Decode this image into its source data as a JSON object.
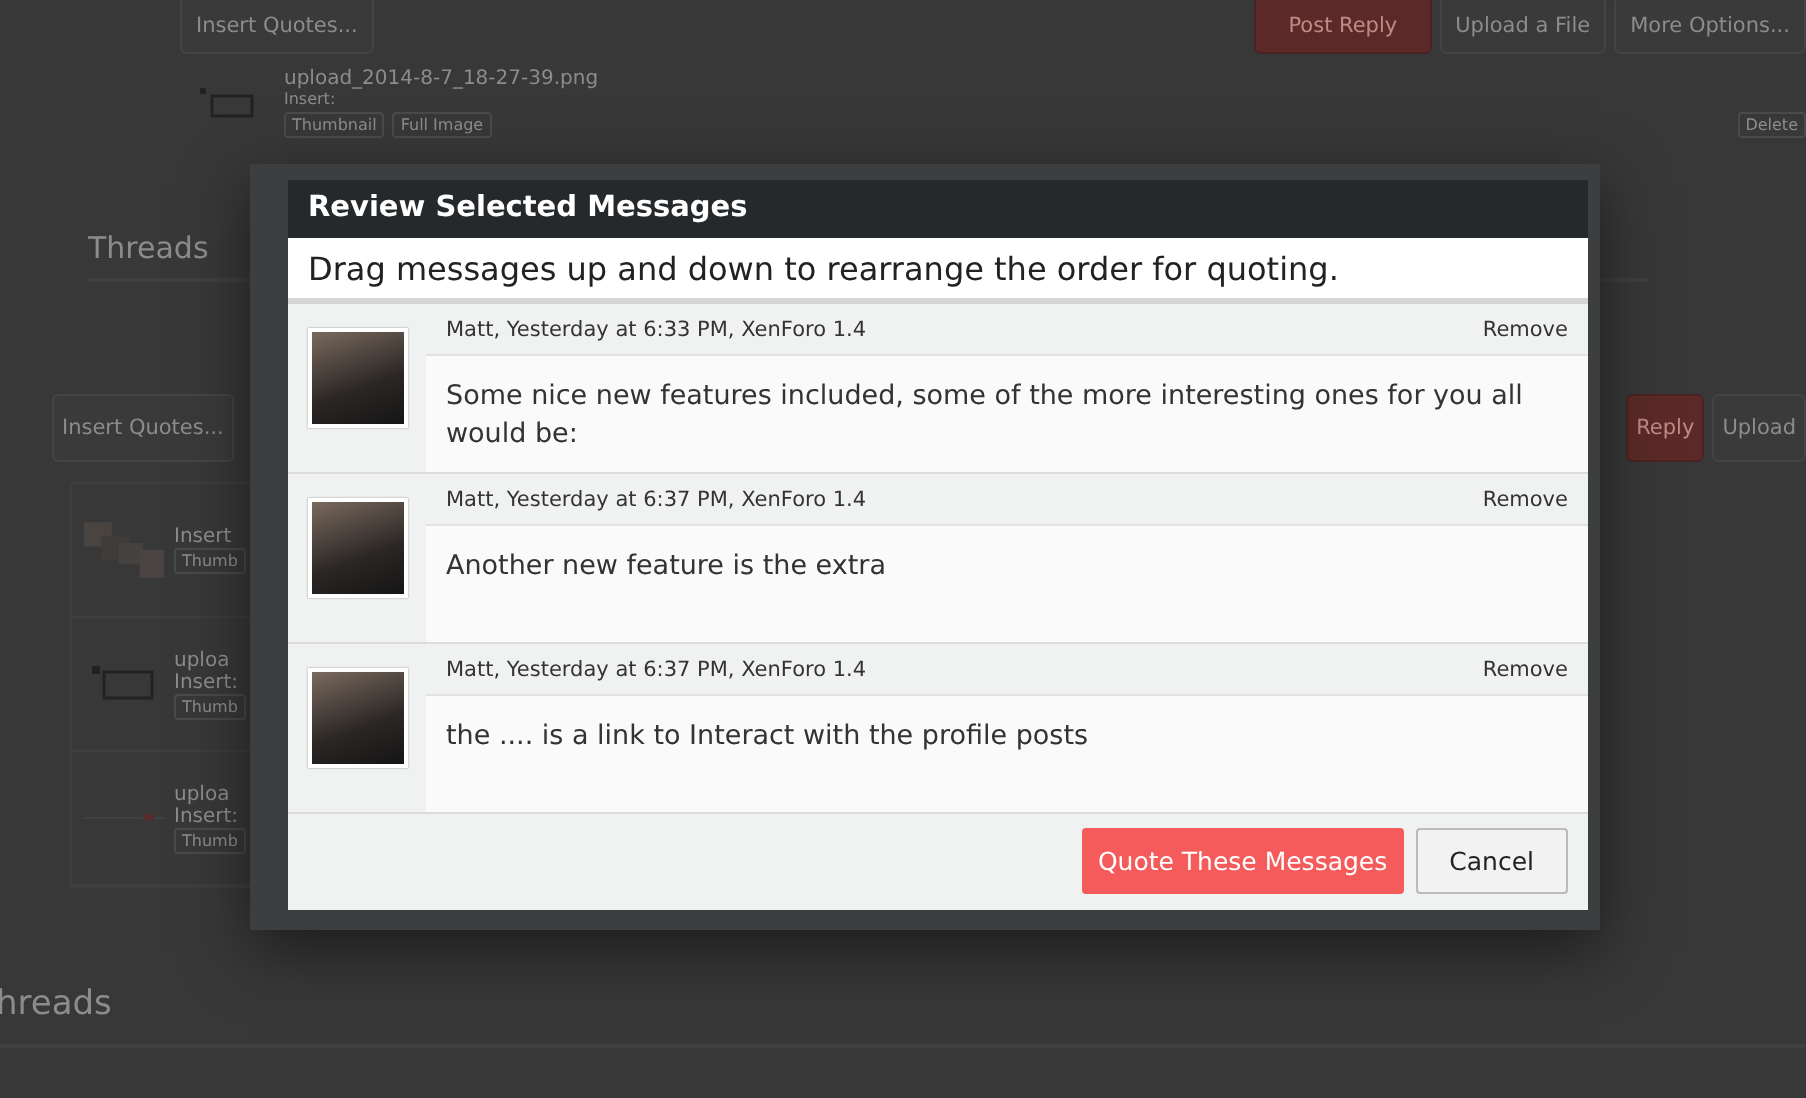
{
  "background": {
    "top_toolbar": {
      "left_button": "Insert Quotes...",
      "right_buttons": [
        {
          "label": "Post Reply",
          "kind": "primary"
        },
        {
          "label": "Upload a File",
          "kind": "plain"
        },
        {
          "label": "More Options...",
          "kind": "plain"
        }
      ]
    },
    "attachment": {
      "filename": "upload_2014-8-7_18-27-39.png",
      "insert_label": "Insert:",
      "buttons": [
        "Thumbnail",
        "Full Image"
      ],
      "delete_button": "Delete"
    },
    "section_title": "Threads",
    "editor_toolbar": {
      "left_button": "Insert Quotes...",
      "right_buttons": [
        {
          "label": "Reply",
          "kind": "primary"
        },
        {
          "label": "Upload",
          "kind": "plain"
        }
      ]
    },
    "attachments": [
      {
        "kind": "photos",
        "insert_label": "Insert",
        "button": "Thumb"
      },
      {
        "kind": "window",
        "name": "uploa",
        "insert_label": "Insert:",
        "button": "Thumb"
      },
      {
        "kind": "strip",
        "name": "uploa",
        "insert_label": "Insert:",
        "button": "Thumb"
      }
    ],
    "footer_title": "hreads"
  },
  "dialog": {
    "title": "Review Selected Messages",
    "instruction": "Drag messages up and down to rearrange the order for quoting.",
    "messages": [
      {
        "meta": "Matt, Yesterday at 6:33 PM, XenForo 1.4",
        "remove": "Remove",
        "text": "Some nice new features included, some of the more interesting ones for you all would be:"
      },
      {
        "meta": "Matt, Yesterday at 6:37 PM, XenForo 1.4",
        "remove": "Remove",
        "text": "Another new feature is the extra"
      },
      {
        "meta": "Matt, Yesterday at 6:37 PM, XenForo 1.4",
        "remove": "Remove",
        "text": "the .... is a link to Interact with the profile posts"
      }
    ],
    "buttons": [
      {
        "label": "Quote These Messages",
        "kind": "primary"
      },
      {
        "label": "Cancel",
        "kind": "secondary"
      }
    ]
  }
}
